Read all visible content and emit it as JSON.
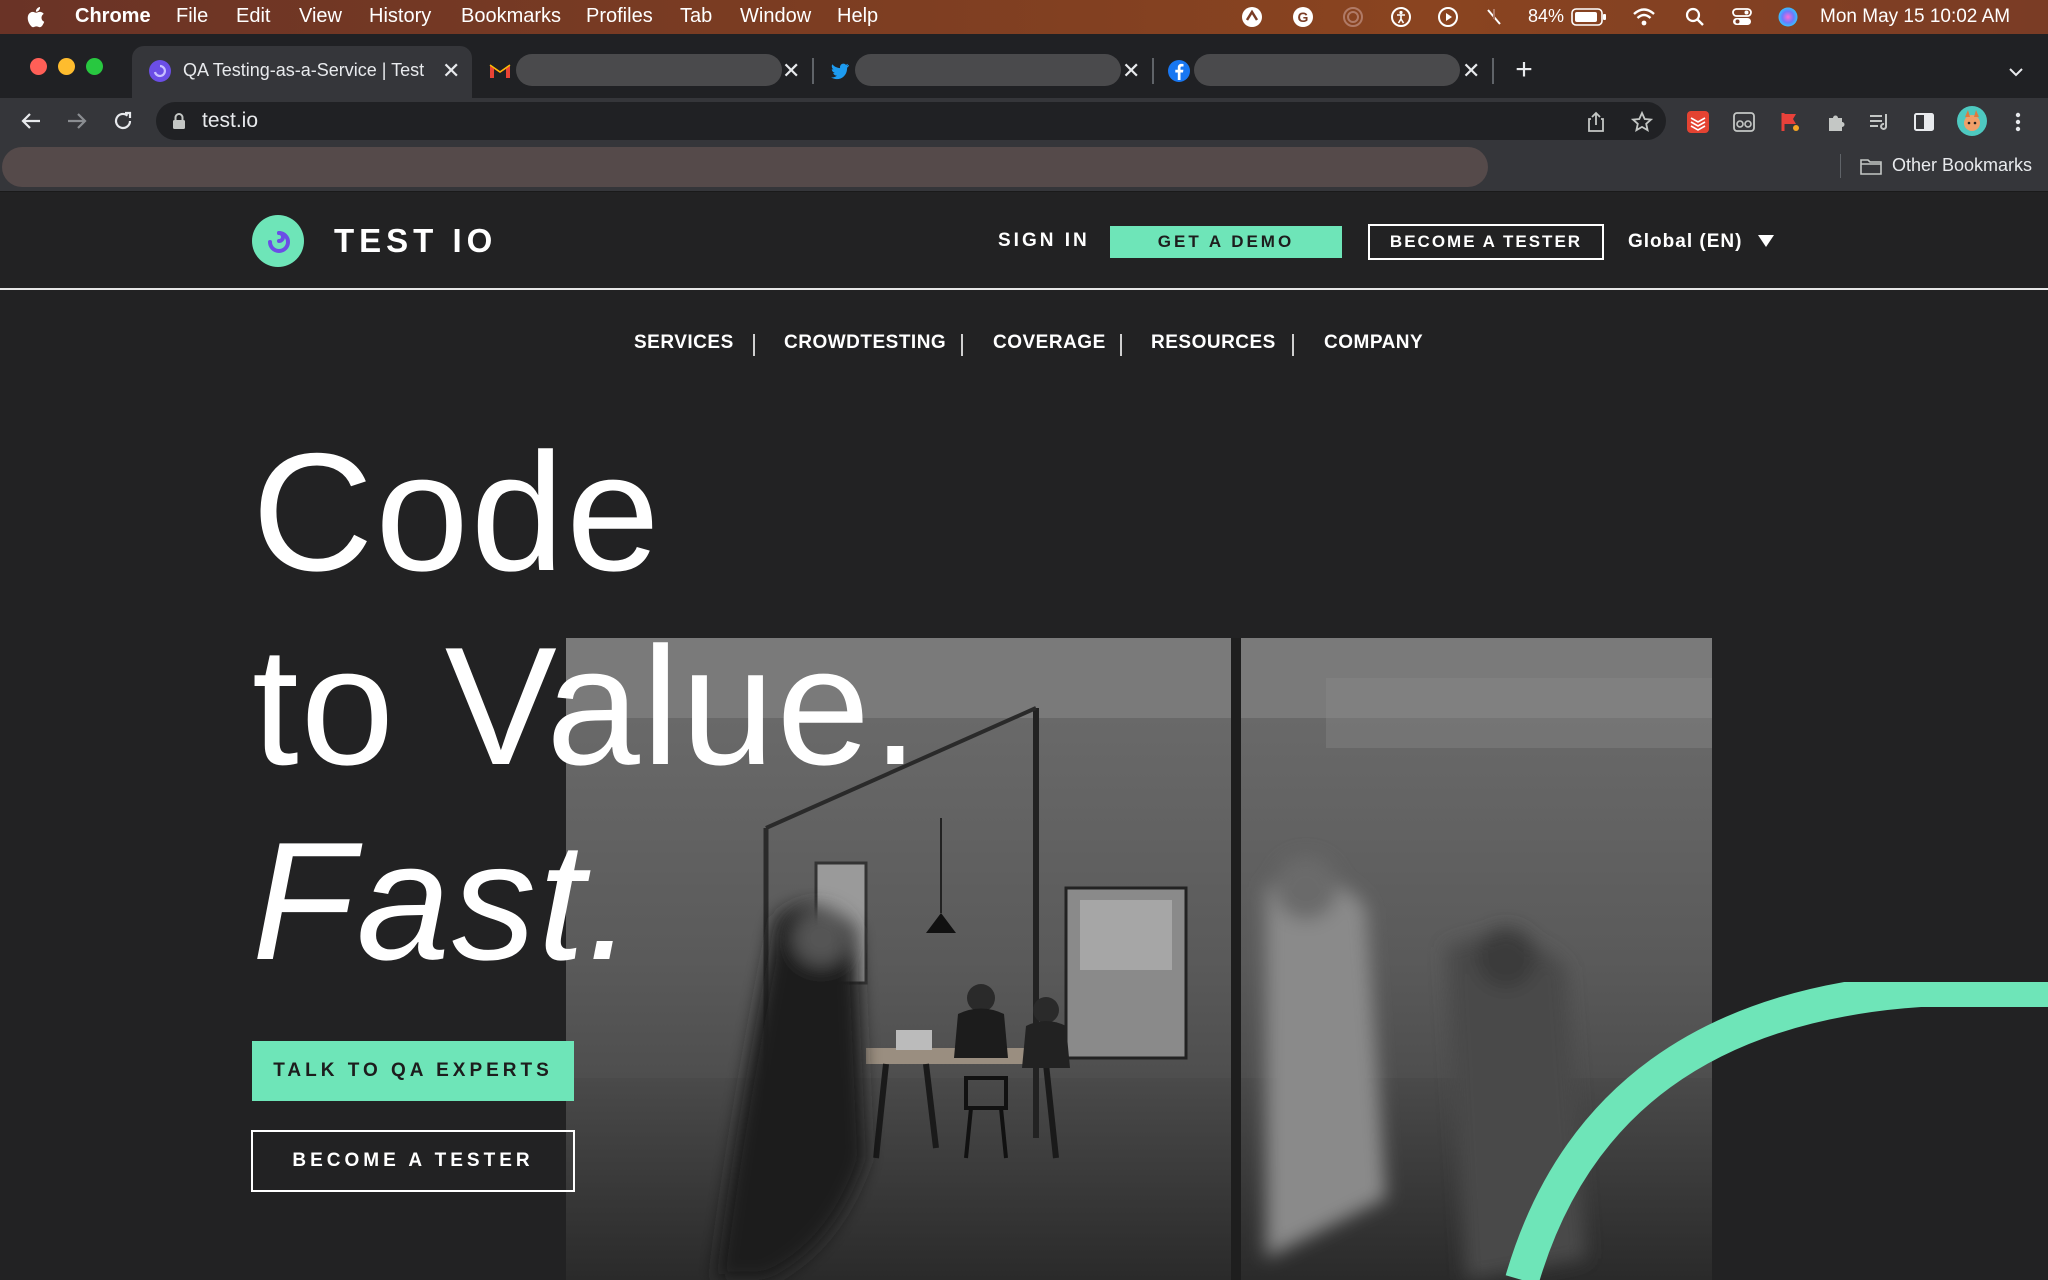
{
  "menubar": {
    "app_name": "Chrome",
    "menus": [
      "File",
      "Edit",
      "View",
      "History",
      "Bookmarks",
      "Profiles",
      "Tab",
      "Window",
      "Help"
    ],
    "battery": "84%",
    "datetime": "Mon May 15  10:02 AM"
  },
  "browser": {
    "tabs": [
      {
        "title": "QA Testing-as-a-Service | Test",
        "icon": "testio-favicon",
        "active": true
      },
      {
        "title": "",
        "icon": "gmail-icon",
        "active": false
      },
      {
        "title": "",
        "icon": "twitter-icon",
        "active": false
      },
      {
        "title": "",
        "icon": "facebook-icon",
        "active": false
      }
    ],
    "url": "test.io",
    "other_bookmarks": "Other Bookmarks"
  },
  "site": {
    "logo_text": "TEST IO",
    "sign_in": "SIGN IN",
    "get_demo": "GET A DEMO",
    "become_tester": "BECOME A TESTER",
    "language": "Global (EN)",
    "nav": [
      "SERVICES",
      "CROWDTESTING",
      "COVERAGE",
      "RESOURCES",
      "COMPANY"
    ],
    "hero": {
      "line1": "Code",
      "line2": "to Value.",
      "line3": "Fast."
    },
    "cta_primary": "TALK TO QA EXPERTS",
    "cta_secondary": "BECOME A TESTER"
  },
  "colors": {
    "accent": "#6ee5b8",
    "background": "#222223"
  }
}
